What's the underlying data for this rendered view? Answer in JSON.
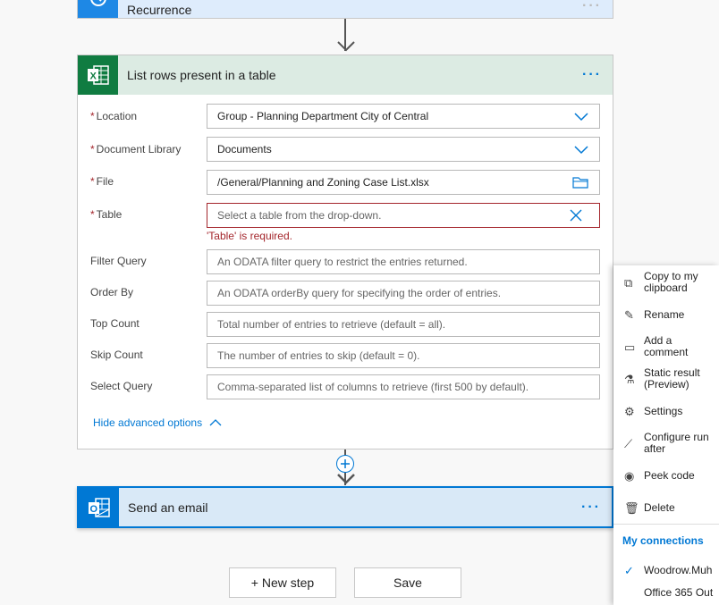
{
  "recurrence": {
    "title": "Recurrence",
    "color": "#1e88e5"
  },
  "excel_card": {
    "title": "List rows present in a table",
    "more": "···",
    "color": "#107c41",
    "fields": [
      {
        "label": "Location",
        "required": true,
        "value": "Group - Planning Department City of Central",
        "control": "dropdown"
      },
      {
        "label": "Document Library",
        "required": true,
        "value": "Documents",
        "control": "dropdown"
      },
      {
        "label": "File",
        "required": true,
        "value": "/General/Planning and Zoning Case List.xlsx",
        "control": "folder"
      },
      {
        "label": "Table",
        "required": true,
        "placeholder": "Select a table from the drop-down.",
        "control": "clear",
        "error": "'Table' is required."
      },
      {
        "label": "Filter Query",
        "placeholder": "An ODATA filter query to restrict the entries returned."
      },
      {
        "label": "Order By",
        "placeholder": "An ODATA orderBy query for specifying the order of entries."
      },
      {
        "label": "Top Count",
        "placeholder": "Total number of entries to retrieve (default = all)."
      },
      {
        "label": "Skip Count",
        "placeholder": "The number of entries to skip (default = 0)."
      },
      {
        "label": "Select Query",
        "placeholder": "Comma-separated list of columns to retrieve (first 500 by default)."
      }
    ],
    "hide_advanced": "Hide advanced options"
  },
  "email_card": {
    "title": "Send an email",
    "more": "···",
    "color": "#0078d4"
  },
  "buttons": {
    "new_step": "+ New step",
    "save": "Save"
  },
  "menu": {
    "items": [
      {
        "label": "Copy to my clipboard",
        "icon": "copy-icon"
      },
      {
        "label": "Rename",
        "icon": "pencil-icon"
      },
      {
        "label": "Add a comment",
        "icon": "comment-icon"
      },
      {
        "label": "Static result (Preview)",
        "icon": "flask-icon"
      },
      {
        "label": "Settings",
        "icon": "gear-icon"
      },
      {
        "label": "Configure run after",
        "icon": "run-after-icon"
      },
      {
        "label": "Peek code",
        "icon": "eye-icon"
      },
      {
        "label": "Delete",
        "icon": "trash-icon"
      }
    ],
    "connections_header": "My connections",
    "connections": [
      {
        "label": "Woodrow.Muh",
        "selected": true
      },
      {
        "label": "Office 365 Out",
        "selected": false
      }
    ]
  }
}
